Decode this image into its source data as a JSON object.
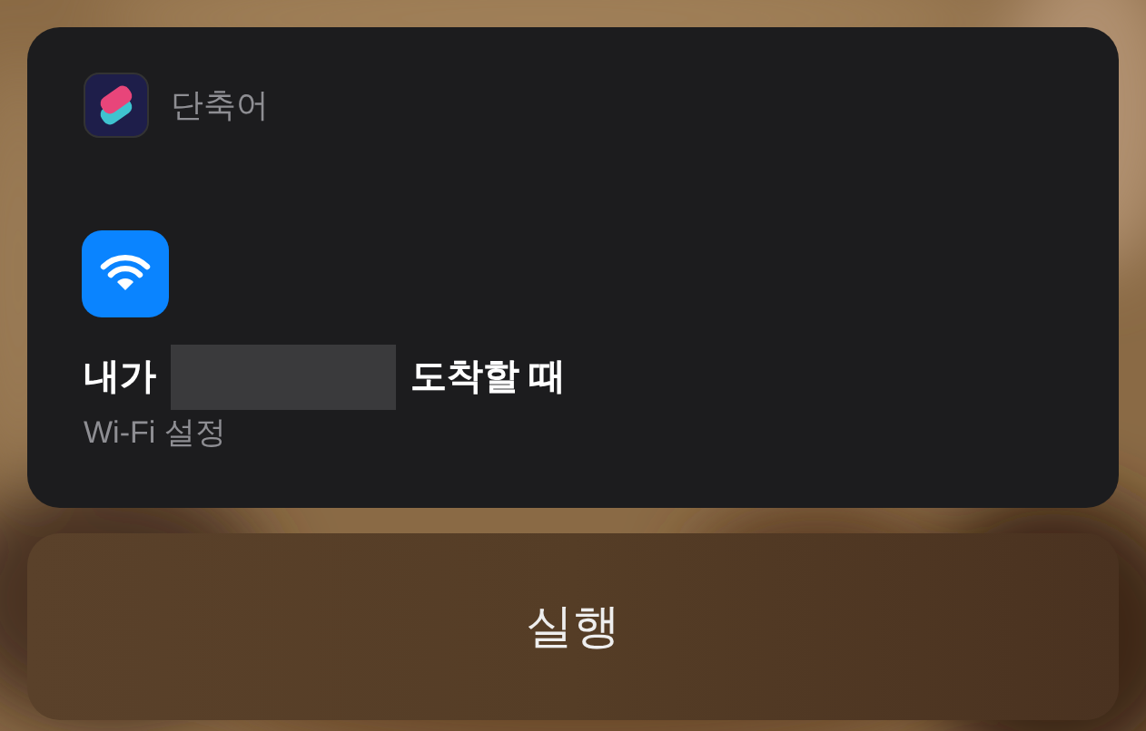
{
  "card": {
    "app_name": "단축어",
    "title_start": "내가",
    "title_end": "도착할 때",
    "subtitle": "Wi-Fi 설정"
  },
  "run_button": {
    "label": "실행"
  }
}
